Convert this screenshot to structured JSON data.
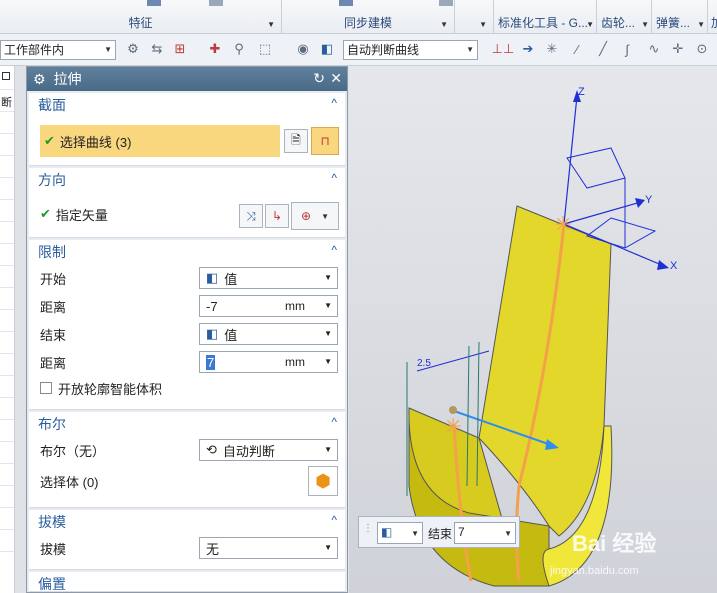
{
  "ribbon": {
    "groups": [
      {
        "label": "特征"
      },
      {
        "label": "同步建模"
      },
      {
        "label": "标准化工具 - G..."
      },
      {
        "label": "齿轮..."
      },
      {
        "label": "弹簧..."
      },
      {
        "label": "加"
      }
    ]
  },
  "toolbar": {
    "assembly_scope": "工作部件内",
    "curve_rule": "自动判断曲线"
  },
  "leftstrip": {
    "header": "断"
  },
  "dialog": {
    "title": "拉伸",
    "section_section": {
      "title": "截面",
      "select_curve": "选择曲线 (3)"
    },
    "section_direction": {
      "title": "方向",
      "specify_vector": "指定矢量"
    },
    "section_limits": {
      "title": "限制",
      "start_label": "开始",
      "start_value": "值",
      "distance1_label": "距离",
      "distance1_value": "-7",
      "distance1_unit": "mm",
      "end_label": "结束",
      "end_value": "值",
      "distance2_label": "距离",
      "distance2_value": "7",
      "distance2_unit": "mm",
      "open_profile": "开放轮廓智能体积"
    },
    "section_boolean": {
      "title": "布尔",
      "boolean_label": "布尔（无）",
      "boolean_value": "自动判断",
      "select_body": "选择体 (0)"
    },
    "section_draft": {
      "title": "拔模",
      "draft_label": "拔模",
      "draft_value": "无"
    },
    "section_offset": {
      "title": "偏置"
    }
  },
  "viewport": {
    "axis_z": "Z",
    "axis_y": "Y",
    "axis_x": "X",
    "dim_label": "2.5"
  },
  "floatbar": {
    "end_label": "结束",
    "end_value": "7"
  },
  "watermark": {
    "text": "Bai 经验",
    "sub": "jingyan.baidu.com"
  },
  "colors": {
    "accent": "#2a5d9e",
    "highlight": "#f9d77e",
    "part": "#e2d72a"
  }
}
